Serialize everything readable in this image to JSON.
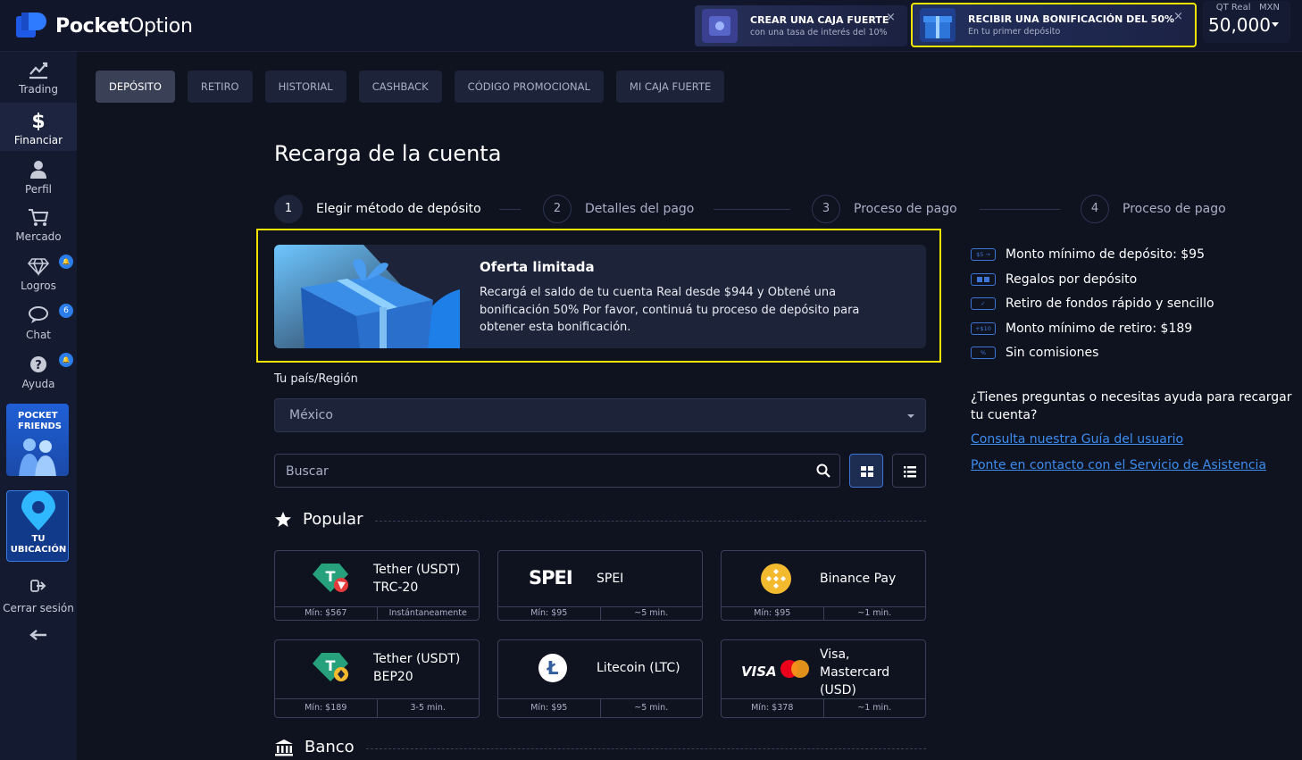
{
  "header": {
    "brand_bold": "Pocket",
    "brand_thin": "Option",
    "promo1": {
      "title": "CREAR UNA CAJA FUERTE",
      "subtitle": "con una tasa de interés del 10%",
      "close": "×"
    },
    "promo2": {
      "title": "RECIBIR UNA BONIFICACIÓN DEL 50%",
      "subtitle": "En tu primer depósito",
      "close": "×"
    },
    "balance": {
      "account_label": "QT Real",
      "currency": "MXN",
      "value": "50,000"
    }
  },
  "sidebar": {
    "items": [
      {
        "label": "Trading",
        "icon": "chart-icon"
      },
      {
        "label": "Financiar",
        "icon": "dollar-icon"
      },
      {
        "label": "Perfil",
        "icon": "user-icon"
      },
      {
        "label": "Mercado",
        "icon": "cart-icon"
      },
      {
        "label": "Logros",
        "icon": "diamond-icon",
        "badge": "🔔"
      },
      {
        "label": "Chat",
        "icon": "chat-icon",
        "badge": "6"
      },
      {
        "label": "Ayuda",
        "icon": "help-icon",
        "badge": "🔔"
      }
    ],
    "friends_card": "POCKET FRIENDS",
    "location_card": "TU UBICACIÓN",
    "logout": "Cerrar sesión"
  },
  "tabs": [
    "DEPÓSITO",
    "RETIRO",
    "HISTORIAL",
    "CASHBACK",
    "CÓDIGO PROMOCIONAL",
    "MI CAJA FUERTE"
  ],
  "page_title": "Recarga de la cuenta",
  "steps": [
    {
      "num": "1",
      "label": "Elegir método de depósito"
    },
    {
      "num": "2",
      "label": "Detalles del pago"
    },
    {
      "num": "3",
      "label": "Proceso de pago"
    },
    {
      "num": "4",
      "label": "Proceso de pago"
    }
  ],
  "offer": {
    "title": "Oferta limitada",
    "description": "Recargá el saldo de tu cuenta Real desde $944 y Obtené una bonificación 50% Por favor, continuá tu proceso de depósito para obtener esta bonificación."
  },
  "country": {
    "label": "Tu país/Región",
    "value": "México"
  },
  "search": {
    "placeholder": "Buscar"
  },
  "sections": {
    "popular": "Popular",
    "bank": "Banco"
  },
  "methods": [
    {
      "name": "Tether (USDT) TRC-20",
      "min": "Mín: $567",
      "time": "Instántaneamente"
    },
    {
      "name": "SPEI",
      "logo_text": "SPEI",
      "min": "Mín: $95",
      "time": "~5 min."
    },
    {
      "name": "Binance Pay",
      "min": "Mín: $95",
      "time": "~1 min."
    },
    {
      "name": "Tether (USDT) BEP20",
      "min": "Mín: $189",
      "time": "3-5 min."
    },
    {
      "name": "Litecoin (LTC)",
      "min": "Mín: $95",
      "time": "~5 min."
    },
    {
      "name": "Visa, Mastercard (USD)",
      "logo_text": "VISA",
      "min": "Mín: $378",
      "time": "~1 min."
    }
  ],
  "info": [
    {
      "badge": "$5 →",
      "text": "Monto mínimo de depósito: $95"
    },
    {
      "badge": "",
      "text": "Regalos por depósito"
    },
    {
      "badge": "✓",
      "text": "Retiro de fondos rápido y sencillo"
    },
    {
      "badge": "+$10",
      "text": "Monto mínimo de retiro: $189"
    },
    {
      "badge": "%",
      "text": "Sin comisiones"
    }
  ],
  "help": {
    "question": "¿Tienes preguntas o necesitas ayuda para recargar tu cuenta?",
    "link1": "Consulta nuestra Guía del usuario",
    "link2": "Ponte en contacto con el Servicio de Asistencia"
  },
  "colors": {
    "accent": "#3d74d6",
    "highlight": "#f3e500",
    "bg": "#0f1320",
    "panel": "#1d2338"
  }
}
